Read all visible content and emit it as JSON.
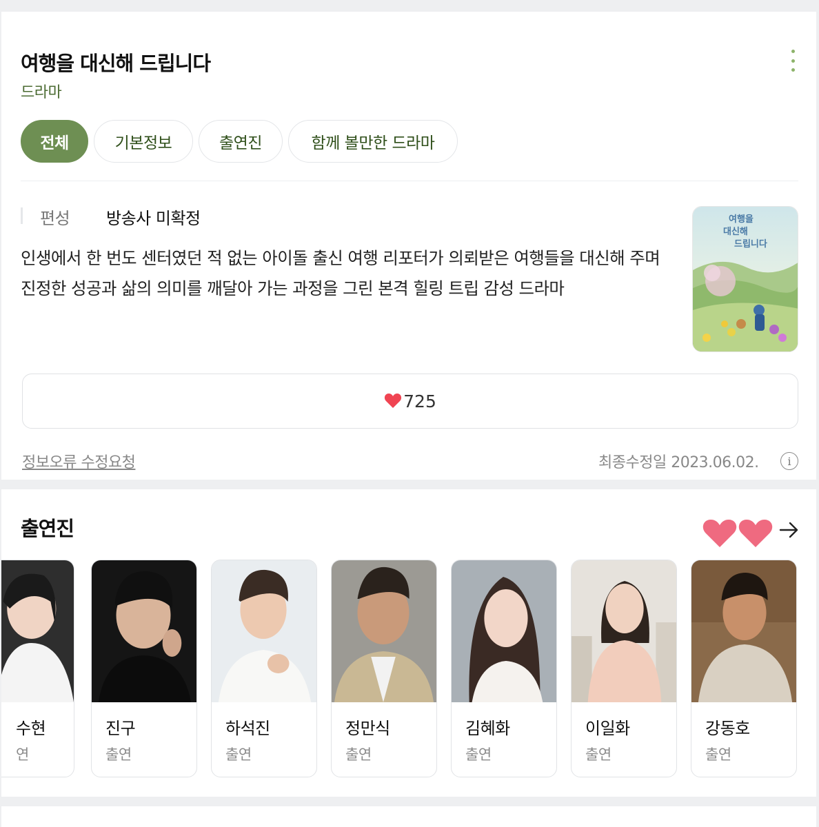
{
  "header": {
    "title": "여행을 대신해 드립니다",
    "category": "드라마"
  },
  "tabs": [
    {
      "label": "전체",
      "active": true
    },
    {
      "label": "기본정보",
      "active": false
    },
    {
      "label": "출연진",
      "active": false
    },
    {
      "label": "함께 볼만한 드라마",
      "active": false
    }
  ],
  "info": {
    "schedule_label": "편성",
    "schedule_value": "방송사 미확정",
    "description": "인생에서 한 번도 센터였던 적 없는 아이돌 출신 여행 리포터가 의뢰받은 여행들을 대신해 주며 진정한 성공과 삶의 의미를 깨달아 가는 과정을 그린 본격 힐링 트립 감성 드라마"
  },
  "poster": {
    "title_text": "여행을 대신해 드립니다"
  },
  "like": {
    "icon": "heart-icon",
    "count": "725",
    "color": "#f04452"
  },
  "footer": {
    "report_label": "정보오류 수정요청",
    "updated_text": "최종수정일 2023.06.02.",
    "info_icon": "info-icon"
  },
  "cast": {
    "title": "출연진",
    "members": [
      {
        "name": "수현",
        "role": "연"
      },
      {
        "name": "진구",
        "role": "출연"
      },
      {
        "name": "하석진",
        "role": "출연"
      },
      {
        "name": "정만식",
        "role": "출연"
      },
      {
        "name": "김혜화",
        "role": "출연"
      },
      {
        "name": "이일화",
        "role": "출연"
      },
      {
        "name": "강동호",
        "role": "출연"
      }
    ]
  },
  "colors": {
    "accent": "#6e8f53",
    "category_text": "#4b6b32",
    "heart": "#f04452"
  }
}
